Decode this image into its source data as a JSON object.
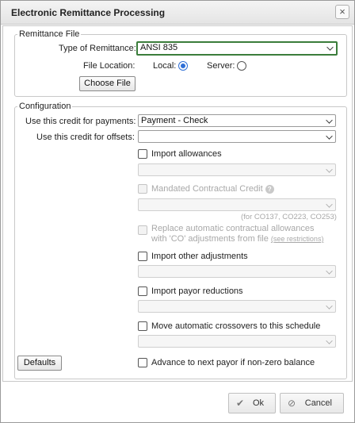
{
  "dialog": {
    "title": "Electronic Remittance Processing",
    "close_glyph": "×"
  },
  "remittance_file": {
    "legend": "Remittance File",
    "type_label": "Type of Remittance:",
    "type_value": "ANSI 835",
    "location_label": "File Location:",
    "local_label": "Local:",
    "server_label": "Server:",
    "location_selected": "Local",
    "choose_file_label": "Choose File"
  },
  "configuration": {
    "legend": "Configuration",
    "payments_label": "Use this credit for payments:",
    "payments_value": "Payment - Check",
    "offsets_label": "Use this credit for offsets:",
    "offsets_value": "",
    "import_allowances": "Import allowances",
    "mandated_credit": "Mandated Contractual Credit",
    "mandated_note": "(for CO137, CO223, CO253)",
    "replace_line1": "Replace automatic contractual allowances",
    "replace_line2": "with 'CO' adjustments from file",
    "see_restrictions": "(see restrictions)",
    "import_other": "Import other adjustments",
    "import_payor": "Import payor reductions",
    "move_crossovers": "Move automatic crossovers to this schedule",
    "advance_payor": "Advance to next payor if non-zero balance",
    "defaults_label": "Defaults"
  },
  "footer": {
    "ok_label": "Ok",
    "cancel_label": "Cancel"
  }
}
